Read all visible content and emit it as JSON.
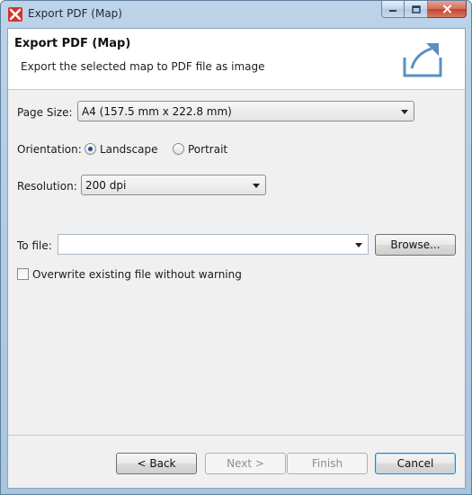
{
  "window": {
    "title": "Export PDF (Map)"
  },
  "banner": {
    "title": "Export PDF (Map)",
    "description": "Export the selected map to PDF file as image",
    "icon": "export-icon"
  },
  "form": {
    "page_size": {
      "label": "Page Size:",
      "value": "A4 (157.5 mm x 222.8 mm)"
    },
    "orientation": {
      "label": "Orientation:",
      "options": [
        {
          "label": "Landscape",
          "selected": true
        },
        {
          "label": "Portrait",
          "selected": false
        }
      ]
    },
    "resolution": {
      "label": "Resolution:",
      "value": "200 dpi"
    },
    "to_file": {
      "label": "To file:",
      "value": "",
      "browse_label": "Browse..."
    },
    "overwrite": {
      "label": "Overwrite existing file without warning",
      "checked": false
    }
  },
  "footer": {
    "back_label": "< Back",
    "next_label": "Next >",
    "finish_label": "Finish",
    "cancel_label": "Cancel"
  },
  "colors": {
    "titlebar": "#bcd3e8",
    "dialog_bg": "#f0f0f0",
    "close_button": "#c2432d",
    "radio_dot": "#1f4f8e",
    "default_button_border": "#3c7fb1"
  }
}
